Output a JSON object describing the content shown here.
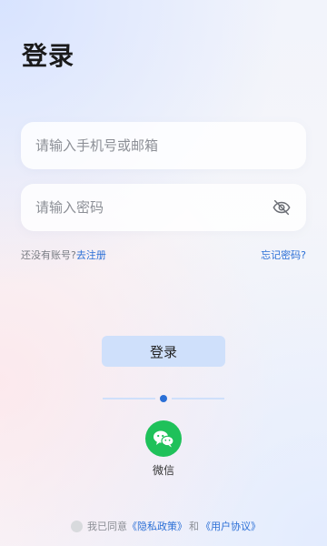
{
  "page": {
    "title": "登录"
  },
  "form": {
    "account_placeholder": "请输入手机号或邮箱",
    "account_value": "",
    "password_placeholder": "请输入密码",
    "password_value": "",
    "password_visibility_icon": "eye-off-icon"
  },
  "links": {
    "no_account_text": "还没有账号?",
    "register": "去注册",
    "forgot_password": "忘记密码?"
  },
  "actions": {
    "login_label": "登录"
  },
  "third_party": {
    "wechat_label": "微信",
    "wechat_icon": "wechat-icon"
  },
  "agreement": {
    "prefix": "我已同意",
    "privacy_policy": "《隐私政策》",
    "and": "和",
    "user_agreement": "《用户协议》"
  },
  "colors": {
    "accent": "#2b6fd6",
    "button_bg": "#cfe0fb",
    "wechat_green": "#1fc15a"
  }
}
